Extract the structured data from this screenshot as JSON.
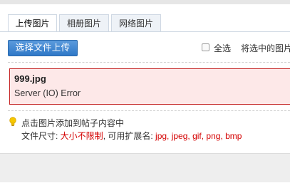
{
  "tabs": [
    {
      "label": "上传图片",
      "active": true
    },
    {
      "label": "相册图片",
      "active": false
    },
    {
      "label": "网络图片",
      "active": false
    }
  ],
  "toolbar": {
    "upload_button": "选择文件上传",
    "select_all_label": "全选",
    "insert_selected_label": "将选中的图片"
  },
  "upload_error": {
    "filename": "999.jpg",
    "message": "Server (IO) Error"
  },
  "tip": {
    "line1": "点击图片添加到帖子内容中",
    "size_prefix": "文件尺寸: ",
    "size_value": "大小不限制",
    "ext_prefix": ", 可用扩展名: ",
    "ext_value": "jpg, jpeg, gif, png, bmp"
  },
  "colors": {
    "accent_blue": "#2f78c8",
    "error_border": "#c62828",
    "error_bg": "#fde8e8",
    "highlight_red": "#d40000"
  },
  "icons": {
    "tip": "lightbulb-icon"
  }
}
